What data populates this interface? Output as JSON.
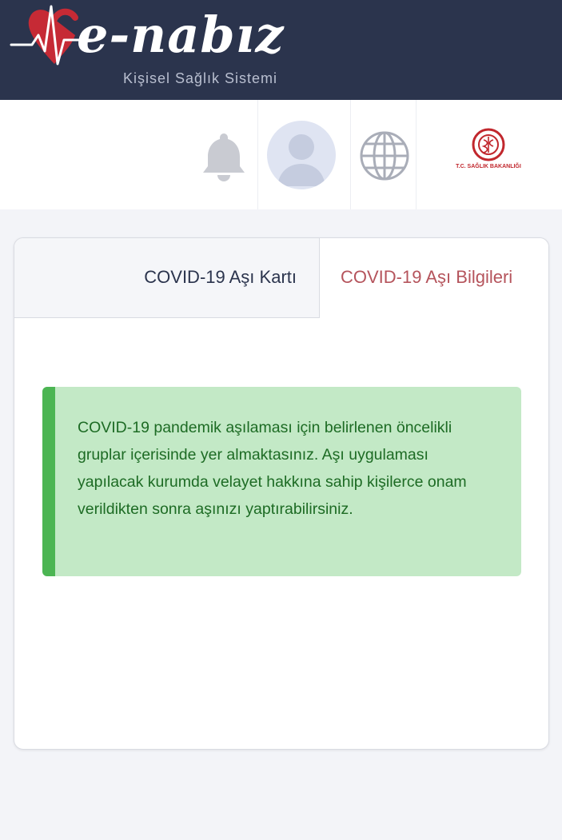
{
  "header": {
    "logo_text": "e-nabız",
    "logo_subtitle": "Kişisel Sağlık Sistemi"
  },
  "navbar": {
    "icons": [
      "bell-icon",
      "avatar-icon",
      "globe-icon",
      "ministry-logo"
    ],
    "ministry_label": "T.C. SAĞLIK BAKANLIĞI"
  },
  "tabs": [
    {
      "label": "COVID-19 Aşı Kartı",
      "active": false
    },
    {
      "label": "COVID-19 Aşı Bilgileri",
      "active": true
    }
  ],
  "alert": {
    "text": "COVID-19 pandemik aşılaması için belirlenen öncelikli gruplar içerisinde yer almaktasınız. Aşı uygulaması yapılacak kurumda velayet hakkına sahip kişilerce onam verildikten sonra aşınızı yaptırabilirsiniz."
  },
  "colors": {
    "header_bg": "#2b344d",
    "active_tab_text": "#b5545c",
    "alert_bg": "#c3e9c6",
    "alert_bar": "#4cb553",
    "alert_text": "#1d6b24"
  }
}
